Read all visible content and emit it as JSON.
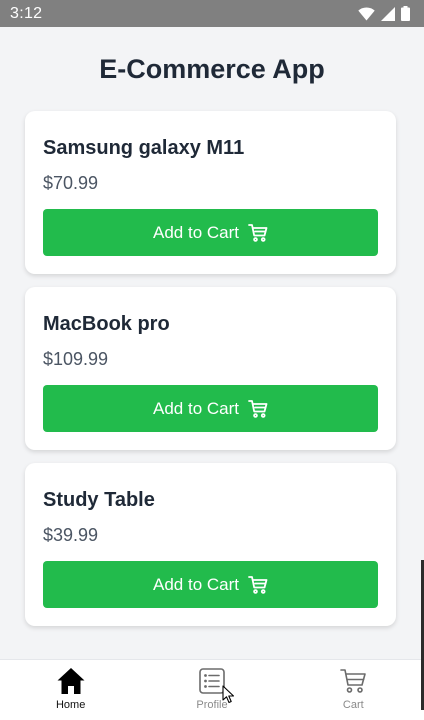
{
  "status_bar": {
    "time": "3:12",
    "icons": [
      "wifi-icon",
      "signal-icon",
      "battery-icon"
    ]
  },
  "app": {
    "title": "E-Commerce App"
  },
  "products": [
    {
      "name": "Samsung galaxy M11",
      "price": "$70.99",
      "button_label": "Add to Cart"
    },
    {
      "name": "MacBook pro",
      "price": "$109.99",
      "button_label": "Add to Cart"
    },
    {
      "name": "Study Table",
      "price": "$39.99",
      "button_label": "Add to Cart"
    }
  ],
  "bottom_nav": {
    "items": [
      {
        "label": "Home",
        "icon": "home-icon",
        "active": true
      },
      {
        "label": "Profile",
        "icon": "list-icon",
        "active": false
      },
      {
        "label": "Cart",
        "icon": "cart-icon",
        "active": false
      }
    ]
  },
  "colors": {
    "accent": "#22bb4c",
    "background": "#f3f4f6",
    "status_bar": "#808080",
    "title_text": "#1f2937"
  }
}
